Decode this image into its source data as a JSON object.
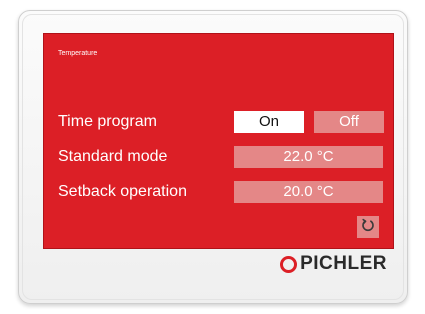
{
  "screen": {
    "title": "Temperature",
    "background_color": "#dc1f26"
  },
  "time_program": {
    "label": "Time program",
    "on_label": "On",
    "off_label": "Off",
    "selected": "On"
  },
  "standard_mode": {
    "label": "Standard mode",
    "value": "22.0 °C"
  },
  "setback_operation": {
    "label": "Setback operation",
    "value": "20.0 °C"
  },
  "reset_button": {
    "icon": "reset-icon"
  },
  "brand": {
    "name": "PICHLER",
    "logo_icon": "ring-icon",
    "accent_color": "#dc1f26"
  }
}
